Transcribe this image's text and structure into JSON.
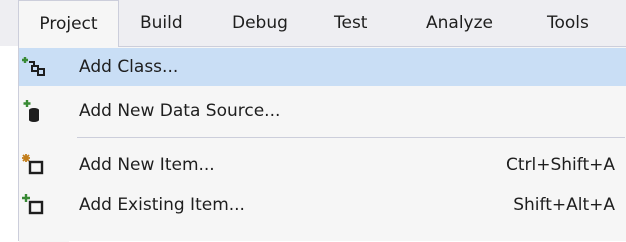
{
  "menubar": {
    "items": [
      {
        "label": "Project"
      },
      {
        "label": "Build"
      },
      {
        "label": "Debug"
      },
      {
        "label": "Test"
      },
      {
        "label": "Analyze"
      },
      {
        "label": "Tools"
      }
    ],
    "open_item": "Project"
  },
  "dropdown": {
    "items": [
      {
        "label": "Add Class...",
        "shortcut": "",
        "icon": "add-class-icon",
        "highlighted": true
      },
      {
        "label": "Add New Data Source...",
        "shortcut": "",
        "icon": "add-data-source-icon",
        "highlighted": false
      },
      {
        "label": "Add New Item...",
        "shortcut": "Ctrl+Shift+A",
        "icon": "add-new-item-icon",
        "highlighted": false
      },
      {
        "label": "Add Existing Item...",
        "shortcut": "Shift+Alt+A",
        "icon": "add-existing-item-icon",
        "highlighted": false
      }
    ]
  },
  "colors": {
    "menubar_bg": "#eeeef2",
    "menu_bg": "#f6f6f6",
    "highlight": "#c9def5",
    "border": "#cccedb",
    "icon_dark": "#1e1e1e",
    "icon_green": "#388a34",
    "icon_gold": "#c27d1a"
  }
}
